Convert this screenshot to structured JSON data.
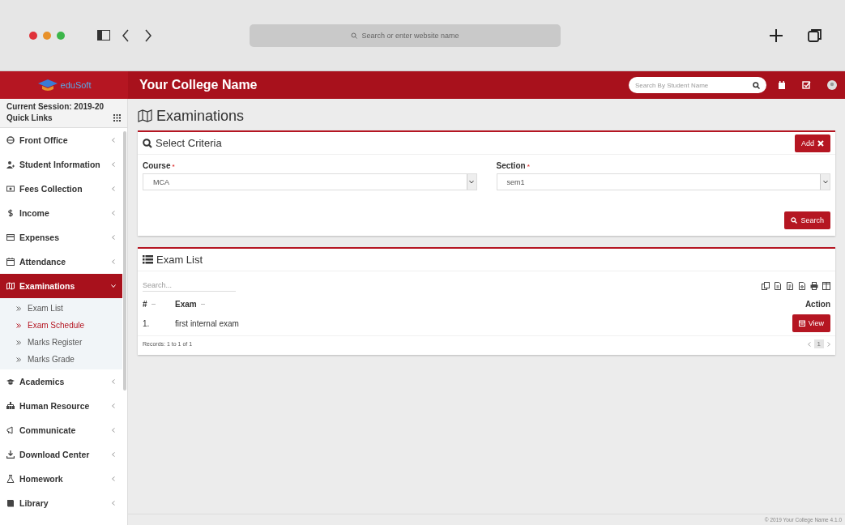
{
  "browser": {
    "address_placeholder": "Search or enter website name"
  },
  "header": {
    "logo_text": "eduSoft",
    "title": "Your College Name",
    "search_placeholder": "Search By Student Name"
  },
  "sidebar": {
    "session": "Current Session: 2019-20",
    "quick_links": "Quick Links",
    "items": [
      {
        "label": "Front Office",
        "expanded": false,
        "selected": false
      },
      {
        "label": "Student Information",
        "expanded": false,
        "selected": false
      },
      {
        "label": "Fees Collection",
        "expanded": false,
        "selected": false
      },
      {
        "label": "Income",
        "expanded": false,
        "selected": false
      },
      {
        "label": "Expenses",
        "expanded": false,
        "selected": false
      },
      {
        "label": "Attendance",
        "expanded": false,
        "selected": false
      },
      {
        "label": "Examinations",
        "expanded": true,
        "selected": true,
        "children": [
          {
            "label": "Exam List",
            "selected": false
          },
          {
            "label": "Exam Schedule",
            "selected": true
          },
          {
            "label": "Marks Register",
            "selected": false
          },
          {
            "label": "Marks Grade",
            "selected": false
          }
        ]
      },
      {
        "label": "Academics",
        "expanded": false,
        "selected": false
      },
      {
        "label": "Human Resource",
        "expanded": false,
        "selected": false
      },
      {
        "label": "Communicate",
        "expanded": false,
        "selected": false
      },
      {
        "label": "Download Center",
        "expanded": false,
        "selected": false
      },
      {
        "label": "Homework",
        "expanded": false,
        "selected": false
      },
      {
        "label": "Library",
        "expanded": false,
        "selected": false
      }
    ]
  },
  "page_title": "Examinations",
  "criteria": {
    "title": "Select Criteria",
    "add_button": "Add",
    "fields": [
      {
        "label": "Course",
        "mark": "*",
        "value": "MCA"
      },
      {
        "label": "Section",
        "mark": "*",
        "value": "sem1"
      }
    ],
    "search_button": "Search"
  },
  "exam_list": {
    "title": "Exam List",
    "search_placeholder": "Search...",
    "columns": [
      {
        "label": "#",
        "sortable": true
      },
      {
        "label": "Exam",
        "sortable": true
      },
      {
        "label": "Action",
        "sortable": false
      }
    ],
    "rows": [
      {
        "number": "1.",
        "exam": "first internal exam",
        "action": "View"
      }
    ],
    "records": "Records: 1 to 1 of 1",
    "pages": [
      {
        "label": "1",
        "selected": true
      }
    ]
  },
  "footer": "© 2019 Your College Name 4.1.0"
}
